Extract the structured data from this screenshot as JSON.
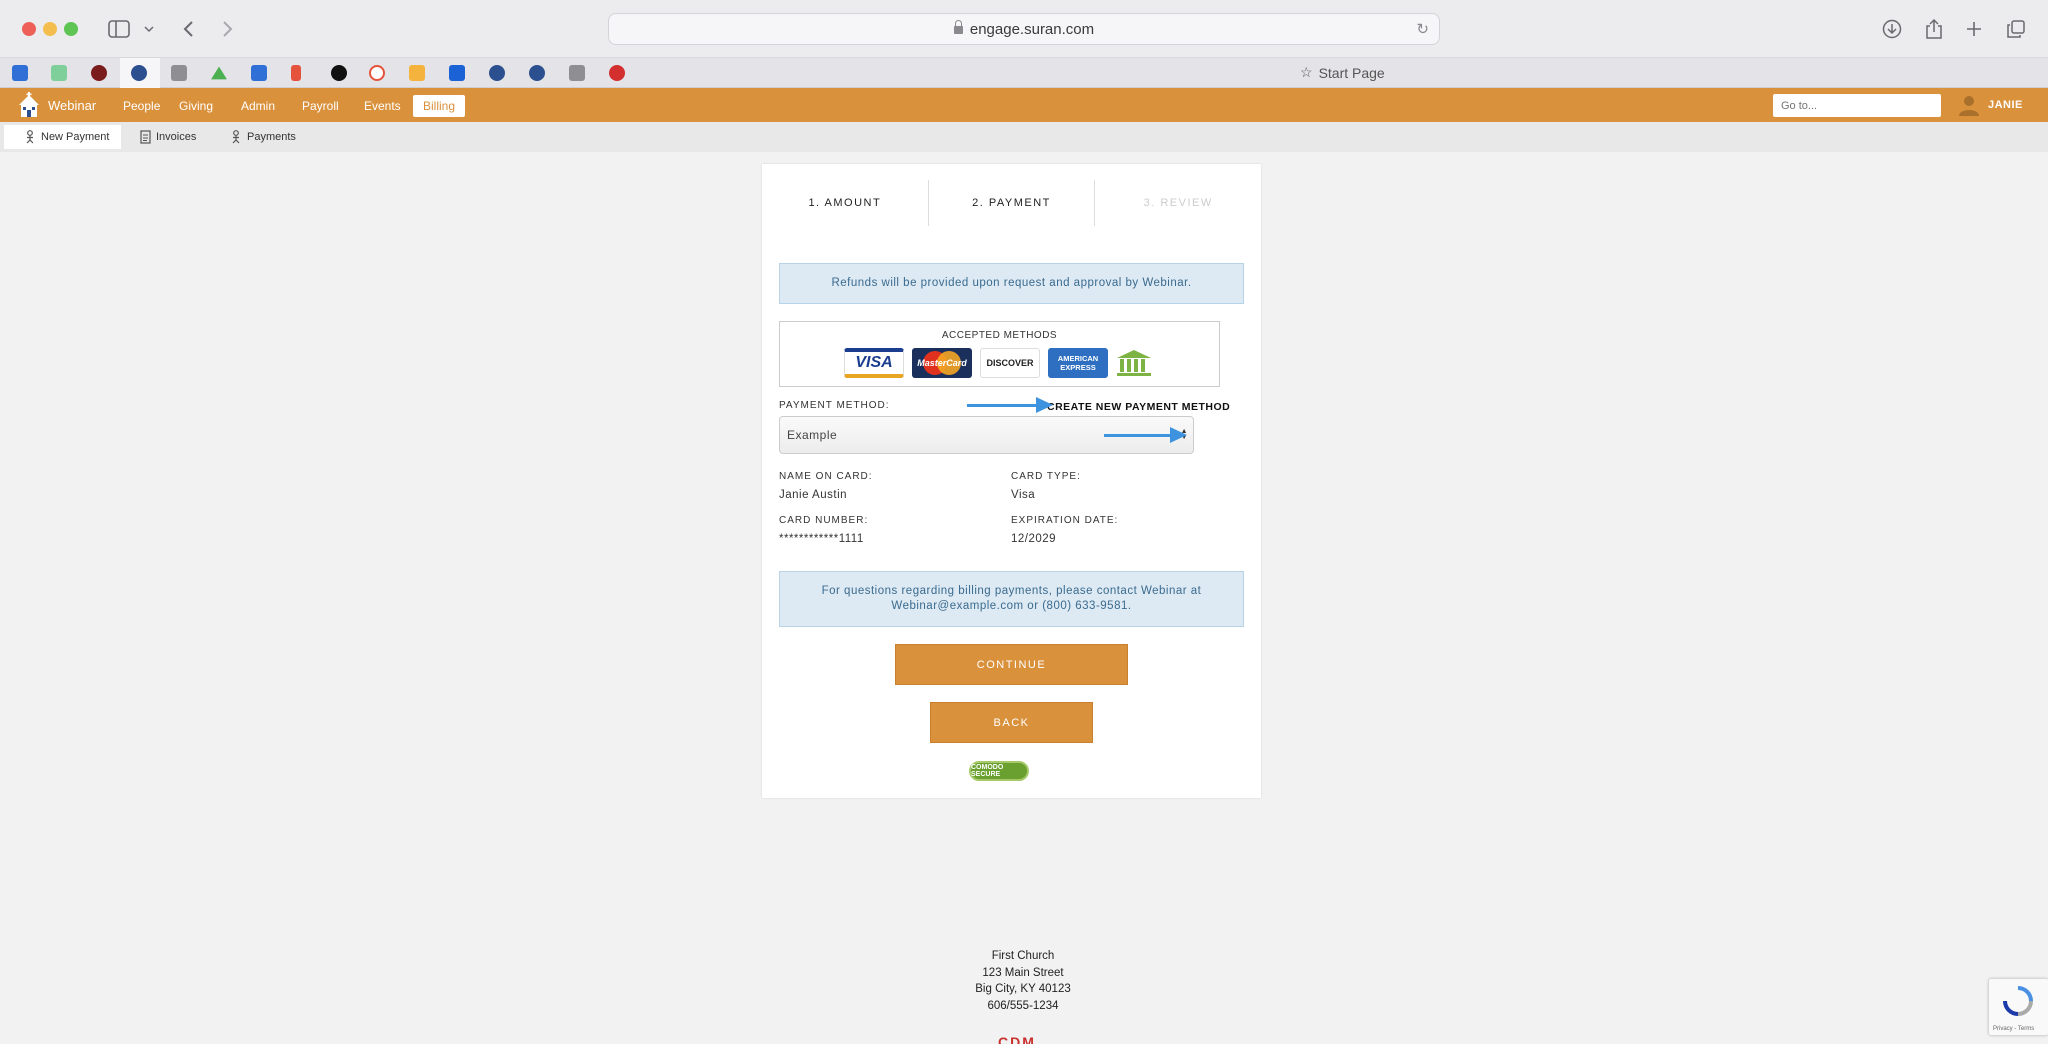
{
  "browser": {
    "url": "engage.suran.com",
    "start_page": "Start Page",
    "favicons": [
      "jira-icon",
      "sheets-icon",
      "circle-app-icon",
      "people-icon",
      "a-app-icon",
      "drive-icon",
      "jira-icon",
      "figma-icon",
      "spotify-icon",
      "clock-icon",
      "tasks-icon",
      "box-icon",
      "people-icon",
      "people-icon",
      "u-app-icon",
      "red-app-icon"
    ]
  },
  "app": {
    "brand": "Webinar",
    "nav": [
      "People",
      "Giving",
      "Admin",
      "Payroll",
      "Events",
      "Billing"
    ],
    "active_nav": "Billing",
    "goto_placeholder": "Go to...",
    "user": "JANIE",
    "accent": "#da913c"
  },
  "subnav": {
    "new_payment": "New Payment",
    "invoices": "Invoices",
    "payments": "Payments"
  },
  "steps": [
    "1. AMOUNT",
    "2. PAYMENT",
    "3. REVIEW"
  ],
  "refund_notice": "Refunds will be provided upon request and approval by Webinar.",
  "accepted": {
    "title": "ACCEPTED METHODS",
    "visa": "VISA",
    "mastercard": "MasterCard",
    "discover": "DISCOVER",
    "amex": "AMERICAN EXPRESS"
  },
  "payment": {
    "method_label": "PAYMENT METHOD:",
    "create_link": "CREATE NEW PAYMENT METHOD",
    "selected": "Example",
    "name_label": "NAME ON CARD:",
    "name_value": "Janie Austin",
    "type_label": "CARD TYPE:",
    "type_value": "Visa",
    "number_label": "CARD NUMBER:",
    "number_value": "************1111",
    "exp_label": "EXPIRATION DATE:",
    "exp_value": "12/2029"
  },
  "contact_notice": {
    "line1": "For questions regarding billing payments, please contact Webinar at",
    "line2": "Webinar@example.com or (800) 633-9581."
  },
  "buttons": {
    "continue": "CONTINUE",
    "back": "BACK"
  },
  "secure_badge": "COMODO SECURE",
  "footer": {
    "org": "First Church",
    "street": "123 Main Street",
    "city": "Big City, KY 40123",
    "phone": "606/555-1234",
    "logo": "CDM"
  },
  "recaptcha": "Privacy - Terms"
}
